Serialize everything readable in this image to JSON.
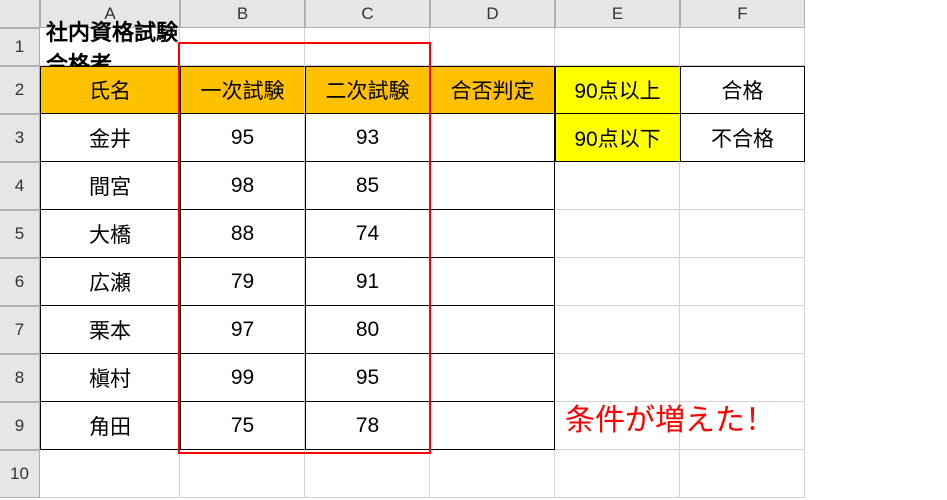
{
  "columns": [
    "A",
    "B",
    "C",
    "D",
    "E",
    "F"
  ],
  "rows": [
    "1",
    "2",
    "3",
    "4",
    "5",
    "6",
    "7",
    "8",
    "9",
    "10"
  ],
  "title": "社内資格試験合格者",
  "headers": {
    "name": "氏名",
    "exam1": "一次試験",
    "exam2": "二次試験",
    "judgment": "合否判定"
  },
  "legend": {
    "above": {
      "label": "90点以上",
      "result": "合格"
    },
    "below": {
      "label": "90点以下",
      "result": "不合格"
    }
  },
  "data": [
    {
      "name": "金井",
      "exam1": 95,
      "exam2": 93
    },
    {
      "name": "間宮",
      "exam1": 98,
      "exam2": 85
    },
    {
      "name": "大橋",
      "exam1": 88,
      "exam2": 74
    },
    {
      "name": "広瀬",
      "exam1": 79,
      "exam2": 91
    },
    {
      "name": "栗本",
      "exam1": 97,
      "exam2": 80
    },
    {
      "name": "槇村",
      "exam1": 99,
      "exam2": 95
    },
    {
      "name": "角田",
      "exam1": 75,
      "exam2": 78
    }
  ],
  "annotation": "条件が増えた！"
}
